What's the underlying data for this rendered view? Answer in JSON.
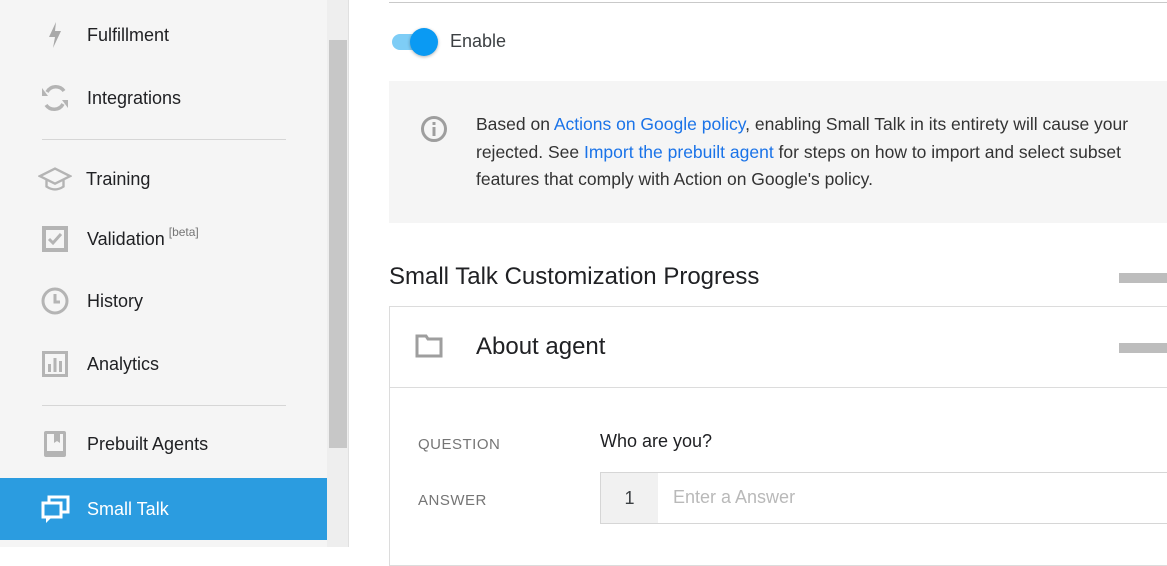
{
  "sidebar": {
    "items": [
      {
        "label": "Fulfillment",
        "icon": "bolt-icon"
      },
      {
        "label": "Integrations",
        "icon": "sync-icon"
      },
      {
        "label": "Training",
        "icon": "graduation-cap-icon"
      },
      {
        "label": "Validation",
        "badge": "[beta]",
        "icon": "checkbox-icon"
      },
      {
        "label": "History",
        "icon": "clock-icon"
      },
      {
        "label": "Analytics",
        "icon": "bar-chart-icon"
      },
      {
        "label": "Prebuilt Agents",
        "icon": "book-icon"
      },
      {
        "label": "Small Talk",
        "icon": "chat-bubbles-icon",
        "active": true
      }
    ],
    "active_color": "#2b9ce0"
  },
  "main": {
    "toggle": {
      "label": "Enable",
      "on": true
    },
    "info": {
      "t1": "Based on ",
      "link1": "Actions on Google policy",
      "t2": ", enabling Small Talk in its entirety will cause your",
      "t3": "rejected. See ",
      "link2": "Import the prebuilt agent",
      "t4": " for steps on how to import and select subset",
      "t5": "features that comply with Action on Google's policy."
    },
    "section_title": "Small Talk Customization Progress",
    "card": {
      "title": "About agent",
      "question_label": "QUESTION",
      "question": "Who are you?",
      "answer_label": "ANSWER",
      "answer_index": "1",
      "answer_placeholder": "Enter a Answer"
    },
    "link_color": "#1a73e8"
  }
}
